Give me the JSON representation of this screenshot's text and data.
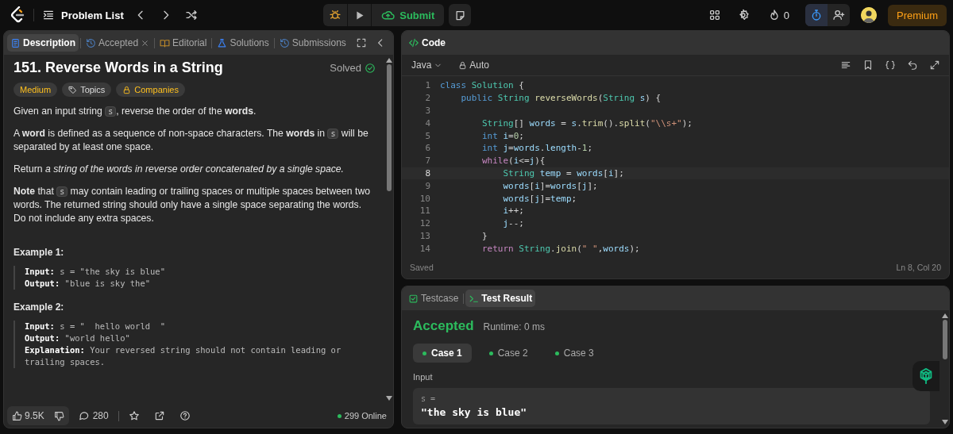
{
  "topbar": {
    "problem_list": "Problem List",
    "submit": "Submit",
    "streak": "0",
    "premium": "Premium"
  },
  "description_panel": {
    "tabs": [
      {
        "label": "Description",
        "kind": "doc",
        "selected": true,
        "closable": false
      },
      {
        "label": "Accepted",
        "kind": "history",
        "selected": false,
        "closable": true
      },
      {
        "label": "Editorial",
        "kind": "book",
        "selected": false,
        "closable": false
      },
      {
        "label": "Solutions",
        "kind": "flask",
        "selected": false,
        "closable": false
      },
      {
        "label": "Submissions",
        "kind": "history",
        "selected": false,
        "closable": false
      }
    ],
    "title": "151. Reverse Words in a String",
    "status": "Solved",
    "tags": [
      {
        "label": "Medium",
        "kind": "difficulty"
      },
      {
        "label": "Topics",
        "kind": "topics"
      },
      {
        "label": "Companies",
        "kind": "companies"
      }
    ],
    "paragraphs": [
      {
        "parts": [
          {
            "kind": "text",
            "text": "Given an input string "
          },
          {
            "kind": "code",
            "text": "s"
          },
          {
            "kind": "text",
            "text": ", reverse the order of the **words**."
          }
        ]
      },
      {
        "parts": [
          {
            "kind": "text",
            "text": "A **word** is defined as a sequence of non-space characters. The **words** in "
          },
          {
            "kind": "code",
            "text": "s"
          },
          {
            "kind": "text",
            "text": " will be separated by at least one space."
          }
        ]
      },
      {
        "parts": [
          {
            "kind": "text",
            "text": "Return *a string of the words in reverse order concatenated by a single space.*"
          }
        ]
      },
      {
        "parts": [
          {
            "kind": "text",
            "text": "**Note** that "
          },
          {
            "kind": "code",
            "text": "s"
          },
          {
            "kind": "text",
            "text": " may contain leading or trailing spaces or multiple spaces between two words. The returned string should only have a single space separating the words. Do not include any extra spaces."
          }
        ]
      }
    ],
    "examples": [
      {
        "title": "Example 1:",
        "lines": [
          {
            "label": "Input:",
            "value": "s = \"the sky is blue\""
          },
          {
            "label": "Output:",
            "value": "\"blue is sky the\""
          }
        ]
      },
      {
        "title": "Example 2:",
        "lines": [
          {
            "label": "Input:",
            "value": "s = \"  hello world  \""
          },
          {
            "label": "Output:",
            "value": "\"world hello\""
          },
          {
            "label": "Explanation:",
            "value": "Your reversed string should not contain leading or trailing spaces."
          }
        ]
      }
    ],
    "footer": {
      "likes": "9.5K",
      "comments": "280",
      "online": "299 Online"
    }
  },
  "code_panel": {
    "title": "Code",
    "language": "Java",
    "mode": "Auto",
    "lines": [
      {
        "number": "1",
        "active": false,
        "tokens": [
          {
            "kind": "keyword",
            "text": "class "
          },
          {
            "kind": "type",
            "text": "Solution"
          },
          {
            "kind": "plain",
            "text": " {"
          }
        ]
      },
      {
        "number": "2",
        "active": false,
        "tokens": [
          {
            "kind": "keyword",
            "text": "    public "
          },
          {
            "kind": "type",
            "text": "String "
          },
          {
            "kind": "func",
            "text": "reverseWords"
          },
          {
            "kind": "plain",
            "text": "("
          },
          {
            "kind": "type",
            "text": "String "
          },
          {
            "kind": "var",
            "text": "s"
          },
          {
            "kind": "plain",
            "text": ") {"
          }
        ]
      },
      {
        "number": "3",
        "active": false
      },
      {
        "number": "4",
        "active": false,
        "tokens": [
          {
            "kind": "type",
            "text": "        String"
          },
          {
            "kind": "plain",
            "text": "[] "
          },
          {
            "kind": "var",
            "text": "words"
          },
          {
            "kind": "plain",
            "text": " = "
          },
          {
            "kind": "var",
            "text": "s"
          },
          {
            "kind": "plain",
            "text": "."
          },
          {
            "kind": "func",
            "text": "trim"
          },
          {
            "kind": "plain",
            "text": "()."
          },
          {
            "kind": "func",
            "text": "split"
          },
          {
            "kind": "plain",
            "text": "("
          },
          {
            "kind": "string",
            "text": "\"\\\\s+\""
          },
          {
            "kind": "plain",
            "text": ");"
          }
        ]
      },
      {
        "number": "5",
        "active": false,
        "tokens": [
          {
            "kind": "keyword",
            "text": "        int "
          },
          {
            "kind": "var",
            "text": "i"
          },
          {
            "kind": "plain",
            "text": "="
          },
          {
            "kind": "number",
            "text": "0"
          },
          {
            "kind": "plain",
            "text": ";"
          }
        ]
      },
      {
        "number": "6",
        "active": false,
        "tokens": [
          {
            "kind": "keyword",
            "text": "        int "
          },
          {
            "kind": "var",
            "text": "j"
          },
          {
            "kind": "plain",
            "text": "="
          },
          {
            "kind": "var",
            "text": "words"
          },
          {
            "kind": "plain",
            "text": "."
          },
          {
            "kind": "var",
            "text": "length"
          },
          {
            "kind": "plain",
            "text": "-"
          },
          {
            "kind": "number",
            "text": "1"
          },
          {
            "kind": "plain",
            "text": ";"
          }
        ]
      },
      {
        "number": "7",
        "active": false,
        "tokens": [
          {
            "kind": "control",
            "text": "        while"
          },
          {
            "kind": "plain",
            "text": "("
          },
          {
            "kind": "var",
            "text": "i"
          },
          {
            "kind": "plain",
            "text": "<="
          },
          {
            "kind": "var",
            "text": "j"
          },
          {
            "kind": "plain",
            "text": "){"
          }
        ]
      },
      {
        "number": "8",
        "active": true,
        "tokens": [
          {
            "kind": "type",
            "text": "            String "
          },
          {
            "kind": "var",
            "text": "temp"
          },
          {
            "kind": "plain",
            "text": " = "
          },
          {
            "kind": "var",
            "text": "words"
          },
          {
            "kind": "plain",
            "text": "["
          },
          {
            "kind": "var",
            "text": "i"
          },
          {
            "kind": "plain",
            "text": "];"
          }
        ]
      },
      {
        "number": "9",
        "active": false,
        "tokens": [
          {
            "kind": "var",
            "text": "            words"
          },
          {
            "kind": "plain",
            "text": "["
          },
          {
            "kind": "var",
            "text": "i"
          },
          {
            "kind": "plain",
            "text": "]="
          },
          {
            "kind": "var",
            "text": "words"
          },
          {
            "kind": "plain",
            "text": "["
          },
          {
            "kind": "var",
            "text": "j"
          },
          {
            "kind": "plain",
            "text": "];"
          }
        ]
      },
      {
        "number": "10",
        "active": false,
        "tokens": [
          {
            "kind": "var",
            "text": "            words"
          },
          {
            "kind": "plain",
            "text": "["
          },
          {
            "kind": "var",
            "text": "j"
          },
          {
            "kind": "plain",
            "text": "]="
          },
          {
            "kind": "var",
            "text": "temp"
          },
          {
            "kind": "plain",
            "text": ";"
          }
        ]
      },
      {
        "number": "11",
        "active": false,
        "tokens": [
          {
            "kind": "var",
            "text": "            i"
          },
          {
            "kind": "plain",
            "text": "++;"
          }
        ]
      },
      {
        "number": "12",
        "active": false,
        "tokens": [
          {
            "kind": "var",
            "text": "            j"
          },
          {
            "kind": "plain",
            "text": "--;"
          }
        ]
      },
      {
        "number": "13",
        "active": false,
        "tokens": [
          {
            "kind": "plain",
            "text": "        }"
          }
        ]
      },
      {
        "number": "14",
        "active": false,
        "tokens": [
          {
            "kind": "control",
            "text": "        return "
          },
          {
            "kind": "type",
            "text": "String"
          },
          {
            "kind": "plain",
            "text": "."
          },
          {
            "kind": "func",
            "text": "join"
          },
          {
            "kind": "plain",
            "text": "("
          },
          {
            "kind": "string",
            "text": "\" \""
          },
          {
            "kind": "plain",
            "text": ","
          },
          {
            "kind": "var",
            "text": "words"
          },
          {
            "kind": "plain",
            "text": ");"
          }
        ]
      }
    ],
    "save_status": "Saved",
    "cursor": "Ln 8, Col 20"
  },
  "test_panel": {
    "tabs": [
      {
        "label": "Testcase",
        "kind": "check",
        "selected": false
      },
      {
        "label": "Test Result",
        "kind": "terminal",
        "selected": true
      }
    ],
    "verdict": "Accepted",
    "runtime": "Runtime: 0 ms",
    "cases": [
      {
        "label": "Case 1",
        "selected": true
      },
      {
        "label": "Case 2",
        "selected": false
      },
      {
        "label": "Case 3",
        "selected": false
      }
    ],
    "input_label": "Input",
    "input_var": "s =",
    "input_value": "\"the sky is blue\""
  }
}
